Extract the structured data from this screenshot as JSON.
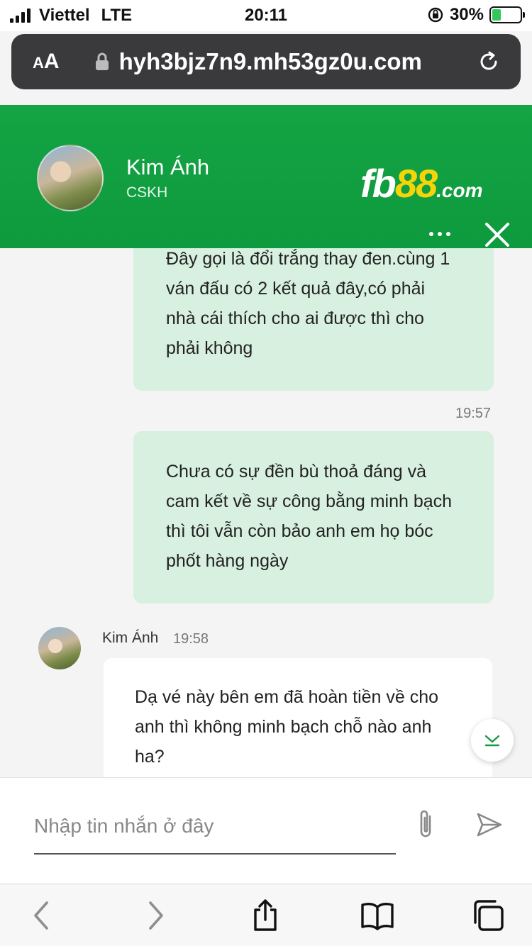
{
  "status_bar": {
    "carrier": "Viettel",
    "network": "LTE",
    "time": "20:11",
    "battery": "30%"
  },
  "browser": {
    "text_size_label_small": "A",
    "text_size_label_large": "A",
    "url": "hyh3bjz7n9.mh53gz0u.com"
  },
  "chat_header": {
    "agent_name": "Kim Ánh",
    "agent_role": "CSKH",
    "brand_fb": "fb",
    "brand_num": "88",
    "brand_com": ".com"
  },
  "messages": {
    "out1": {
      "lines": [
        "Đây gọi là đổi trắng thay đen.cùng 1",
        "ván đấu có 2 kết quả đây,có phải",
        "nhà cái thích cho ai được thì cho",
        "phải không"
      ],
      "time": "19:57"
    },
    "out2": {
      "lines": [
        "Chưa có sự đền bù thoả đáng và",
        "cam kết về sự công bằng minh bạch",
        "thì tôi vẫn còn bảo anh em họ bóc",
        "phốt hàng ngày"
      ]
    },
    "in1": {
      "sender": "Kim Ánh",
      "time": "19:58",
      "lines": [
        "Dạ vé này bên em đã hoàn tiền về cho",
        "anh thì không minh bạch chỗ nào anh",
        "ha?"
      ]
    }
  },
  "composer": {
    "placeholder": "Nhập tin nhắn ở đây"
  },
  "colors": {
    "header_green": "#14a444",
    "outgoing_bubble": "#d8f0df",
    "brand_yellow": "#f6d40a"
  }
}
